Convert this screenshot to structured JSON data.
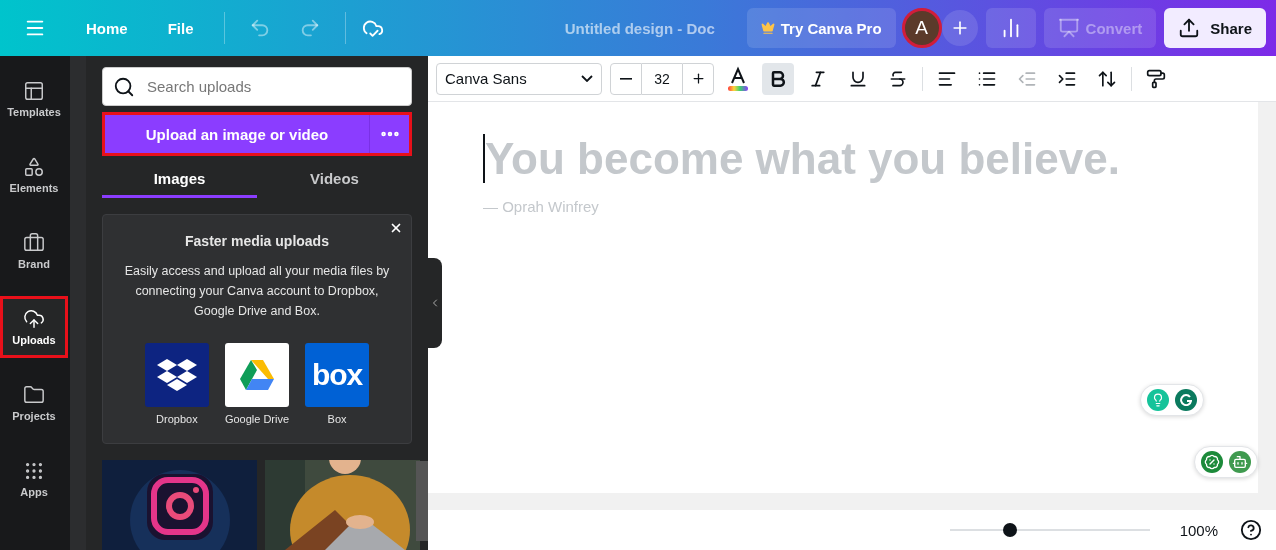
{
  "topbar": {
    "menu_items": [
      {
        "label": "Home"
      },
      {
        "label": "File"
      }
    ],
    "history": [
      {
        "kind": "undo",
        "disabled": true
      },
      {
        "kind": "redo",
        "disabled": true
      }
    ],
    "title": "Untitled design - Doc",
    "pro_button": "Try Canva Pro",
    "avatar": "A",
    "convert": {
      "label": "Convert",
      "disabled": true
    },
    "share": "Share"
  },
  "rail": [
    {
      "label": "Templates",
      "selected": false,
      "highlighted": false
    },
    {
      "label": "Elements",
      "selected": false,
      "highlighted": false
    },
    {
      "label": "Brand",
      "selected": false,
      "highlighted": false
    },
    {
      "label": "Uploads",
      "selected": true,
      "highlighted": true
    },
    {
      "label": "Projects",
      "selected": false,
      "highlighted": false
    },
    {
      "label": "Apps",
      "selected": false,
      "highlighted": false
    }
  ],
  "panel": {
    "search_placeholder": "Search uploads",
    "upload_button": {
      "label": "Upload an image or video",
      "highlighted": true
    },
    "tabs": [
      {
        "label": "Images",
        "selected": true
      },
      {
        "label": "Videos",
        "selected": false
      }
    ],
    "promo": {
      "title": "Faster media uploads",
      "text": "Easily access and upload all your media files by connecting your Canva account to Dropbox, Google Drive and Box.",
      "services": [
        {
          "kind": "dropbox",
          "label": "Dropbox"
        },
        {
          "kind": "drive",
          "label": "Google Drive"
        },
        {
          "kind": "box",
          "label": "Box",
          "logo_text": "box"
        }
      ]
    }
  },
  "toolbar": {
    "font": "Canva Sans",
    "size": "32",
    "toggles": [
      {
        "kind": "bold",
        "on": true
      },
      {
        "kind": "italic",
        "on": false
      },
      {
        "kind": "underline",
        "on": false
      },
      {
        "kind": "strikethrough",
        "on": false
      }
    ]
  },
  "document": {
    "heading": "You become what you believe.",
    "attribution": "— Oprah Winfrey"
  },
  "footer": {
    "zoom": {
      "level": 0.3
    },
    "zoom_reading": "100%"
  }
}
